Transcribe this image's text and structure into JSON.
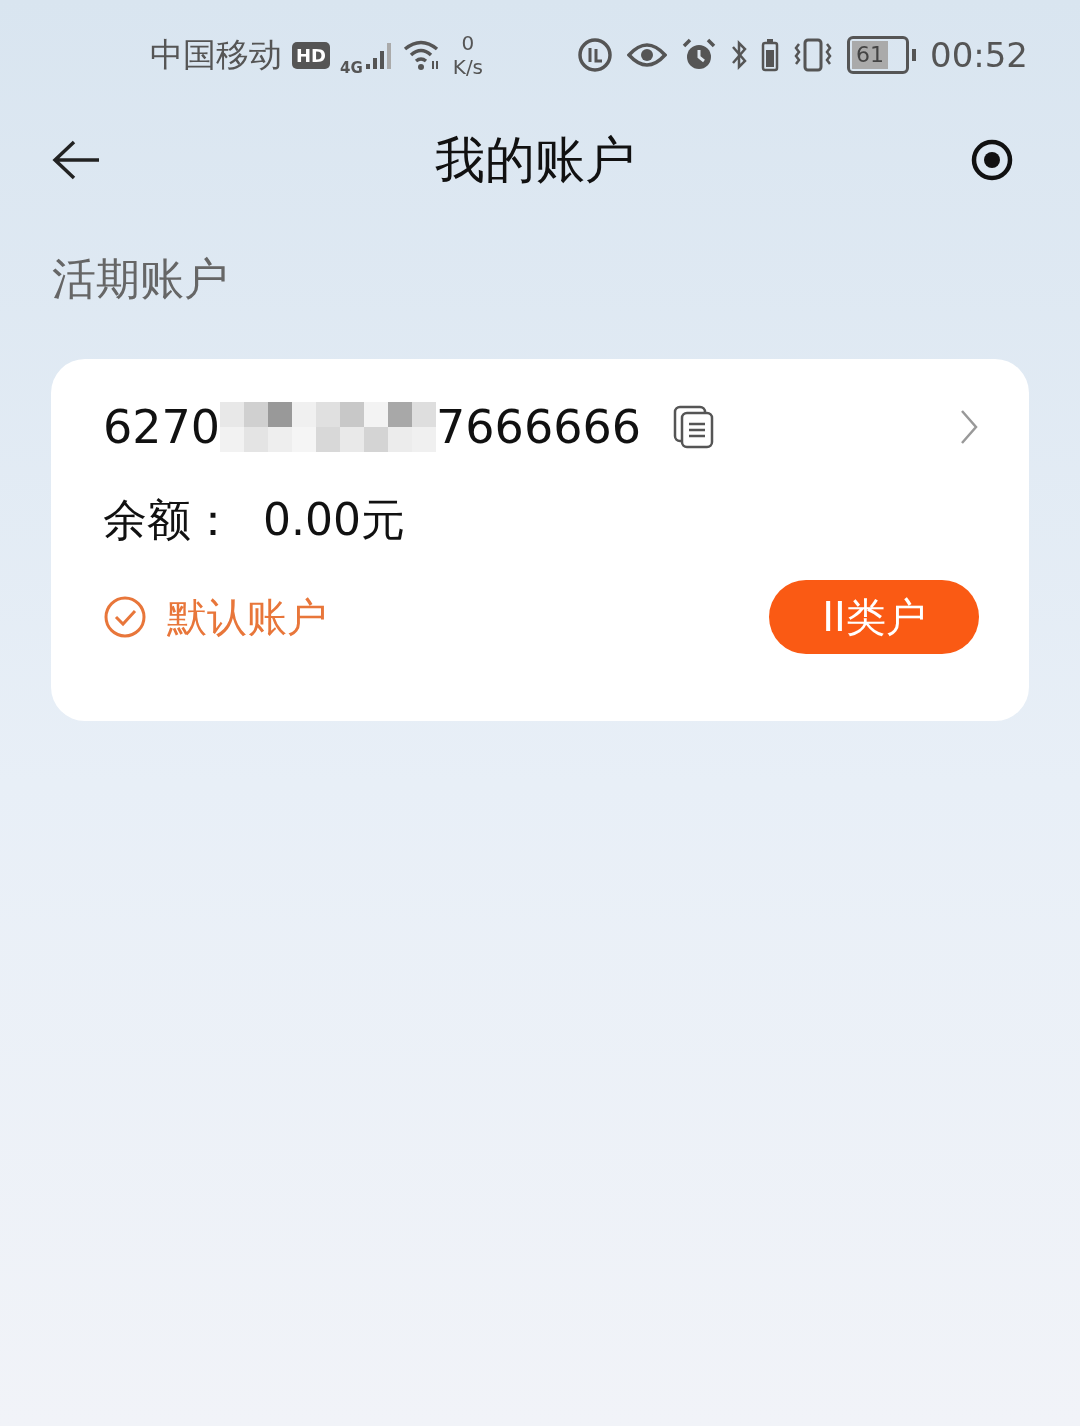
{
  "status_bar": {
    "carrier": "中国移动",
    "hd_badge": "HD",
    "network": "4G",
    "speed_value": "0",
    "speed_unit": "K/s",
    "battery": "61",
    "time": "00:52"
  },
  "header": {
    "title": "我的账户"
  },
  "section_title": "活期账户",
  "account": {
    "number_start": "6270",
    "number_end": "7666666",
    "balance_label": "余额：",
    "balance": "0.00元",
    "default_label": "默认账户",
    "is_default": true,
    "class_button": "II类户"
  }
}
